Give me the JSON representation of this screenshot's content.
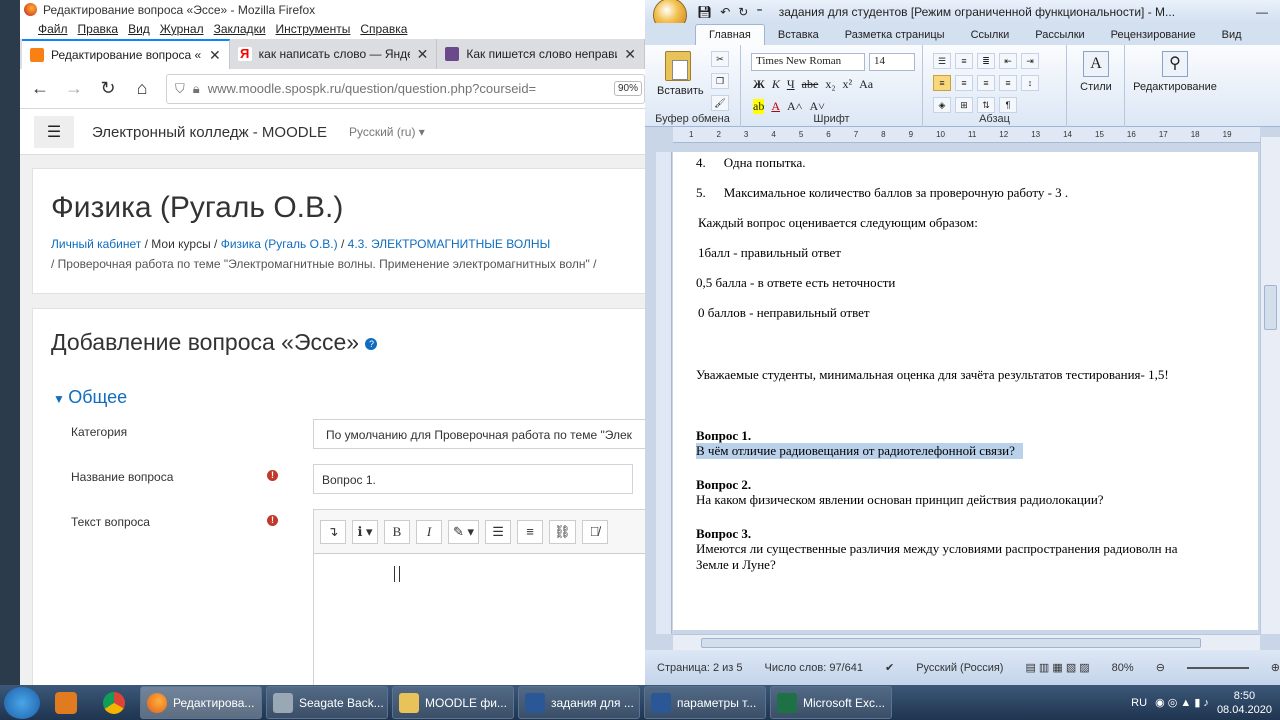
{
  "firefox": {
    "window_title": "Редактирование вопроса «Эссе» - Mozilla Firefox",
    "menu": [
      "Файл",
      "Правка",
      "Вид",
      "Журнал",
      "Закладки",
      "Инструменты",
      "Справка"
    ],
    "tabs": [
      {
        "label": "Редактирование вопроса «Эссе»",
        "close": "✕"
      },
      {
        "label": "как написать слово — Яндекс",
        "close": "✕"
      },
      {
        "label": "Как пишется слово неправильно",
        "close": "✕"
      }
    ],
    "url": "www.moodle.spospk.ru/question/question.php?courseid=",
    "zoom": "90%"
  },
  "moodle": {
    "site_name": "Электронный колледж - MOODLE",
    "language": "Русский (ru) ▾",
    "course_title": "Физика (Ругаль О.В.)",
    "breadcrumb": [
      "Личный кабинет",
      "Мои курсы",
      "Физика (Ругаль О.В.)",
      "4.3. ЭЛЕКТРОМАГНИТНЫЕ ВОЛНЫ"
    ],
    "breadcrumb2": "Проверочная работа по теме \"Электромагнитные волны. Применение электромагнитных волн\"",
    "heading": "Добавление вопроса «Эссе»",
    "section": "Общее",
    "category_label": "Категория",
    "category_value": "По умолчанию для Проверочная работа по теме \"Элек",
    "name_label": "Название вопроса",
    "name_value": "Вопрос 1.",
    "text_label": "Текст вопроса"
  },
  "word": {
    "window_title": "задания для студентов [Режим ограниченной функциональности] - M...",
    "tabs": [
      "Главная",
      "Вставка",
      "Разметка страницы",
      "Ссылки",
      "Рассылки",
      "Рецензирование",
      "Вид"
    ],
    "paste_label": "Вставить",
    "font_name": "Times New Roman",
    "font_size": "14",
    "styles_label": "Стили",
    "editing_label": "Редактирование",
    "group_clipboard": "Буфер обмена",
    "group_font": "Шрифт",
    "group_paragraph": "Абзац",
    "ruler_ticks": [
      "1",
      "2",
      "3",
      "4",
      "5",
      "6",
      "7",
      "8",
      "9",
      "10",
      "11",
      "12",
      "13",
      "14",
      "15",
      "16",
      "17",
      "18",
      "19"
    ],
    "doc": {
      "item4_num": "4.",
      "item4": "Одна попытка.",
      "item5_num": "5.",
      "item5": "Максимальное количество баллов за проверочную работу - 3  .",
      "p1": "Каждый вопрос оценивается следующим образом:",
      "p2": "1балл -    правильный ответ",
      "p3": "0,5 балла  -  в  ответе есть неточности",
      "p4": "0 баллов  -    неправильный ответ",
      "p5": "Уважаемые студенты, минимальная оценка для зачёта результатов тестирования- 1,5!",
      "q1_title": "Вопрос 1.",
      "q1_text": "В чём отличие радиовещания от радиотелефонной связи?",
      "q2_title": "Вопрос 2.",
      "q2_text": "На каком физическом явлении основан принцип действия радиолокации?",
      "q3_title": "Вопрос  3.",
      "q3_text_1": "Имеются ли существенные различия между условиями распространения радиоволн на",
      "q3_text_2": "Земле и Луне?"
    },
    "status_page": "Страница: 2 из 5",
    "status_words": "Число слов: 97/641",
    "status_lang": "Русский (Россия)",
    "status_zoom": "80%"
  },
  "taskbar": {
    "tasks": [
      "Редактирова...",
      "Seagate Back...",
      "MOODLE фи...",
      "задания для ...",
      "параметры т...",
      "Microsoft Exc..."
    ],
    "lang": "RU",
    "time": "8:50",
    "date": "08.04.2020"
  },
  "colors": {
    "moodle_link": "#0f6cbf",
    "required": "#c0392b",
    "word_ribbon": "#dce7f5",
    "highlight": "#b9d1ea"
  }
}
